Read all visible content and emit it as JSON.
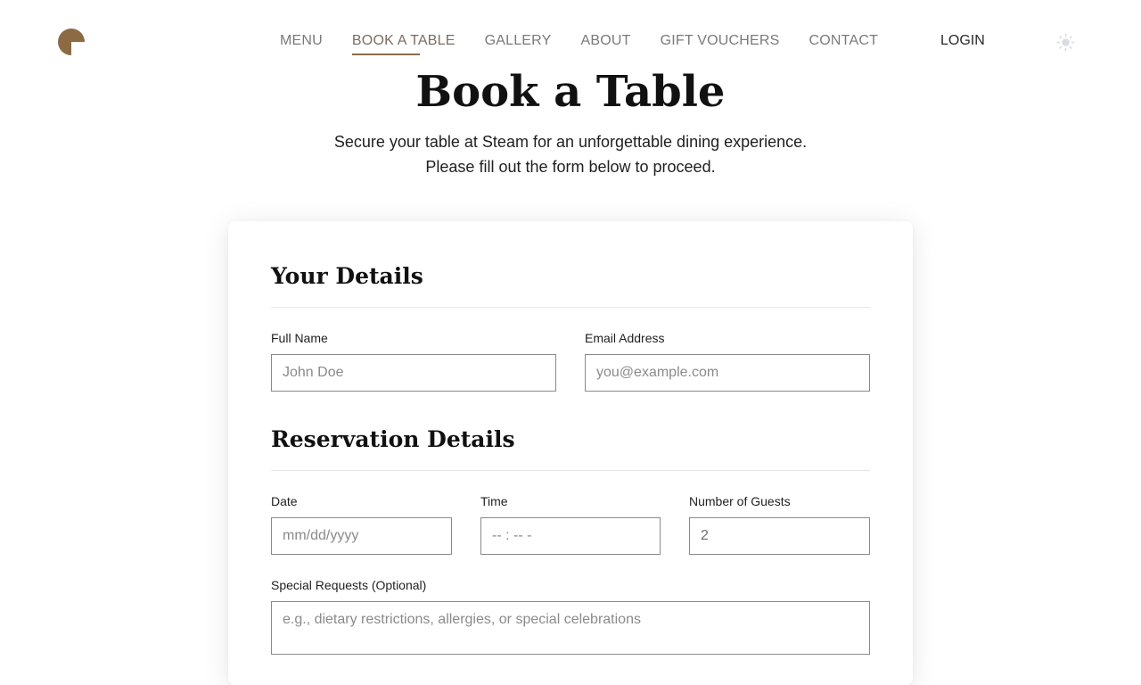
{
  "brand": {
    "accent": "#8c6a44",
    "logo_icon": "quarter-circle-logo"
  },
  "nav": {
    "items": [
      {
        "label": "MENU"
      },
      {
        "label": "BOOK A TABLE",
        "active": true
      },
      {
        "label": "GALLERY"
      },
      {
        "label": "ABOUT"
      },
      {
        "label": "GIFT VOUCHERS"
      },
      {
        "label": "CONTACT"
      }
    ],
    "login_label": "LOGIN",
    "theme_icon": "sun-icon"
  },
  "hero": {
    "title": "Book a Table",
    "subtitle_line1": "Secure your table at Steam for an unforgettable dining experience.",
    "subtitle_line2": "Please fill out the form below to proceed."
  },
  "form": {
    "your_details": {
      "title": "Your Details",
      "full_name": {
        "label": "Full Name",
        "placeholder": "John Doe",
        "value": ""
      },
      "email": {
        "label": "Email Address",
        "placeholder": "you@example.com",
        "value": ""
      }
    },
    "reservation": {
      "title": "Reservation Details",
      "date": {
        "label": "Date",
        "placeholder": "mm/dd/yyyy"
      },
      "time": {
        "label": "Time",
        "placeholder": "-- : -- -"
      },
      "guests": {
        "label": "Number of Guests",
        "value": "2"
      },
      "special": {
        "label": "Special Requests (Optional)",
        "placeholder": "e.g., dietary restrictions, allergies, or special celebrations"
      }
    }
  }
}
